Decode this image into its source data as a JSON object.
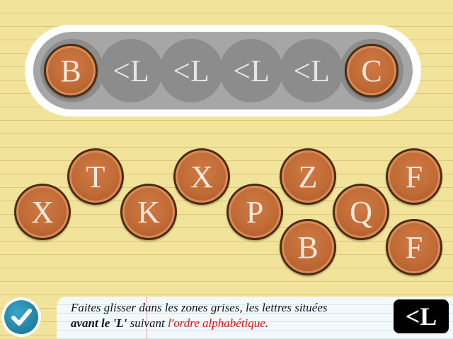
{
  "tray": {
    "slots": [
      {
        "label": "B",
        "filled": true
      },
      {
        "label": "<L",
        "filled": false
      },
      {
        "label": "<L",
        "filled": false
      },
      {
        "label": "<L",
        "filled": false
      },
      {
        "label": "<L",
        "filled": false
      },
      {
        "label": "C",
        "filled": true
      }
    ]
  },
  "coins": [
    "X",
    "T",
    "K",
    "X",
    "P",
    "Z",
    "B",
    "Q",
    "F",
    "F"
  ],
  "instruction": {
    "part1": "Faites glisser dans les zones grises, les lettres situées",
    "part2": "avant le 'L'",
    "part3": "suivant",
    "part4": "l'ordre alphabétique",
    "part5": "."
  },
  "rule_badge": "<L",
  "colors": {
    "background": "#f2e39a",
    "coin": "#c06a35",
    "slot": "#8c8c8c",
    "highlight_red": "#e01010",
    "check_blue": "#1f7fa2"
  },
  "icons": {
    "check": "checkmark-icon"
  }
}
